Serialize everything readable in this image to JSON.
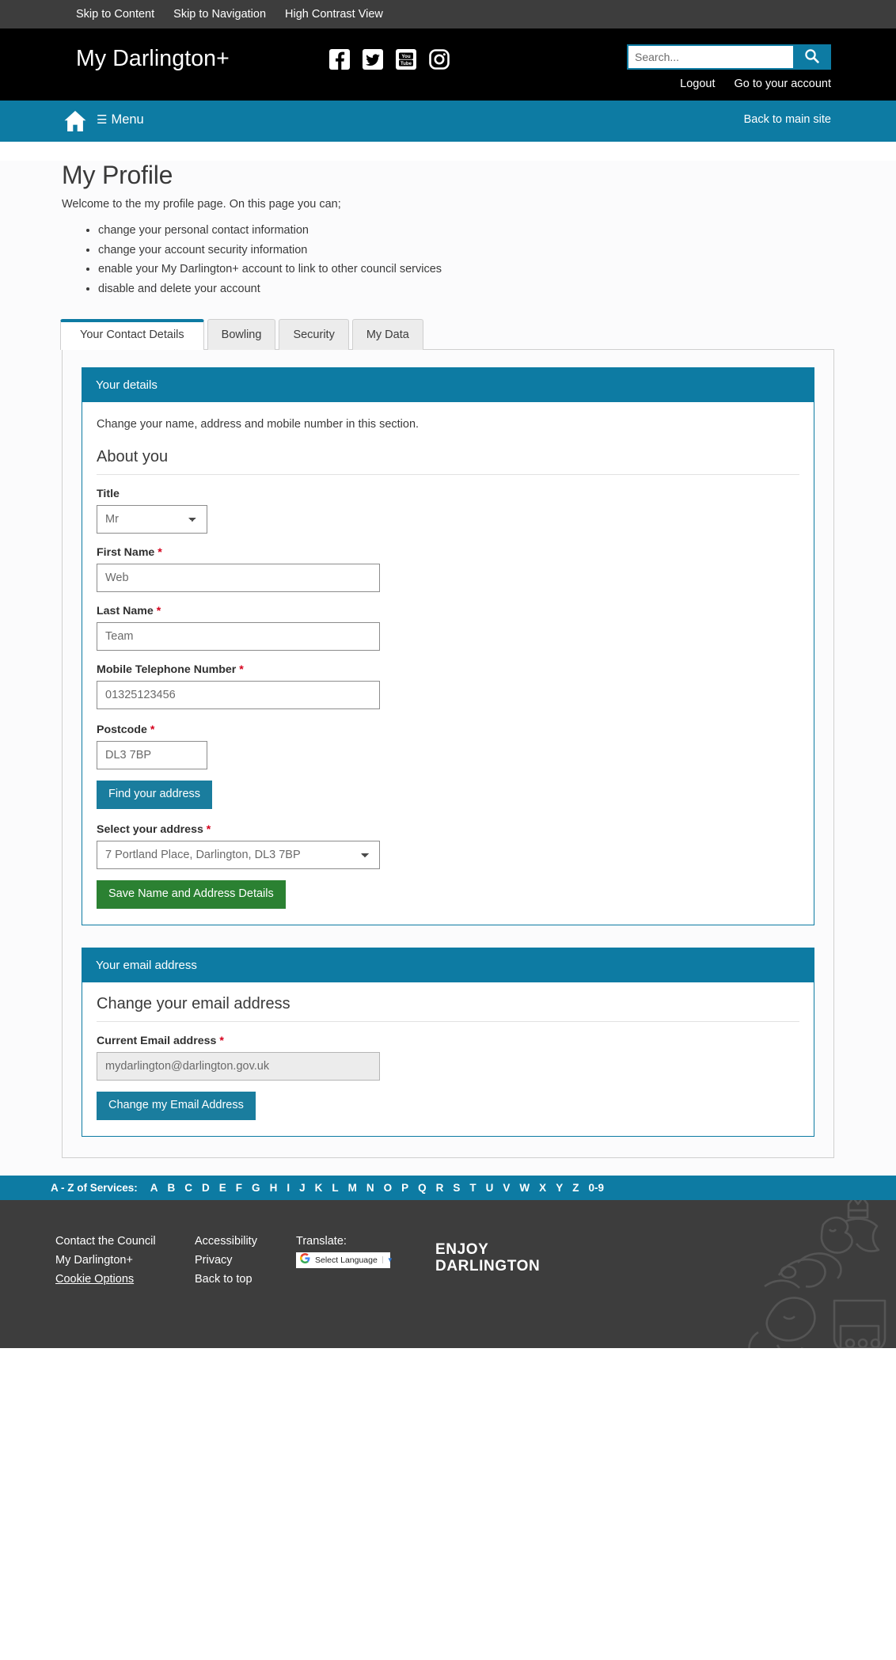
{
  "skip_bar": {
    "links": [
      {
        "label": "Skip to Content",
        "name": "skip-to-content-link"
      },
      {
        "label": "Skip to Navigation",
        "name": "skip-to-navigation-link"
      },
      {
        "label": "High Contrast View",
        "name": "high-contrast-view-link"
      }
    ]
  },
  "masthead": {
    "brand": "My Darlington+",
    "social": [
      {
        "icon": "facebook-icon"
      },
      {
        "icon": "twitter-icon"
      },
      {
        "icon": "youtube-icon"
      },
      {
        "icon": "instagram-icon"
      }
    ],
    "search": {
      "placeholder": "Search...",
      "value": "",
      "button_icon": "search-icon"
    },
    "account_links": [
      {
        "label": "Logout"
      },
      {
        "label": "Go to your account"
      }
    ]
  },
  "navbar": {
    "home_icon": "home-icon",
    "menu_label": "Menu",
    "menu_icon": "hamburger-icon",
    "back_to_main_site": "Back to main site"
  },
  "main": {
    "title": "My Profile",
    "intro": "Welcome to the my profile page. On this page you can;",
    "bullets": [
      "change your personal contact information",
      "change your account security information",
      "enable your My Darlington+ account to link to other council services",
      "disable and delete your account"
    ],
    "tabs": [
      {
        "label": "Your Contact Details",
        "active": true
      },
      {
        "label": "Bowling",
        "active": false
      },
      {
        "label": "Security",
        "active": false
      },
      {
        "label": "My Data",
        "active": false
      }
    ]
  },
  "details_card": {
    "heading": "Your details",
    "description": "Change your name, address and mobile number in this section.",
    "section_heading": "About you",
    "fields": {
      "title": {
        "label": "Title",
        "value": "Mr",
        "required": false
      },
      "first_name": {
        "label": "First Name",
        "value": "Web",
        "required": true
      },
      "last_name": {
        "label": "Last Name",
        "value": "Team",
        "required": true
      },
      "mobile": {
        "label": "Mobile Telephone Number",
        "value": "01325123456",
        "required": true
      },
      "postcode": {
        "label": "Postcode",
        "value": "DL3 7BP",
        "required": true
      },
      "select_address": {
        "label": "Select your address",
        "value": "7 Portland Place, Darlington, DL3 7BP",
        "required": true
      }
    },
    "find_address_button": "Find your address",
    "save_button": "Save Name and Address Details"
  },
  "email_card": {
    "heading": "Your email address",
    "section_heading": "Change your email address",
    "current_email": {
      "label": "Current Email address",
      "value": "mydarlington@darlington.gov.uk",
      "required": true
    },
    "change_button": "Change my Email Address"
  },
  "az_bar": {
    "label": "A - Z of Services:",
    "letters": [
      "A",
      "B",
      "C",
      "D",
      "E",
      "F",
      "G",
      "H",
      "I",
      "J",
      "K",
      "L",
      "M",
      "N",
      "O",
      "P",
      "Q",
      "R",
      "S",
      "T",
      "U",
      "V",
      "W",
      "X",
      "Y",
      "Z",
      "0-9"
    ]
  },
  "footer": {
    "column_1": [
      {
        "label": "Contact the Council",
        "underlined": false
      },
      {
        "label": "My Darlington+",
        "underlined": false
      },
      {
        "label": "Cookie Options",
        "underlined": true
      }
    ],
    "column_2": [
      {
        "label": "Accessibility",
        "underlined": false
      },
      {
        "label": "Privacy",
        "underlined": false
      },
      {
        "label": "Back to top",
        "underlined": false
      }
    ],
    "translate_label": "Translate:",
    "language_selector": {
      "text": "Select Language",
      "icon": "google-icon",
      "caret": "▼"
    },
    "enjoy_line1": "ENJOY",
    "enjoy_line2": "DARLINGTON",
    "crest_icon": "coat-of-arms-icon"
  },
  "theme": {
    "teal": "#0d7ba3",
    "green": "#2b8132",
    "dark": "#3d3d3d",
    "required_red": "#d5001c"
  }
}
